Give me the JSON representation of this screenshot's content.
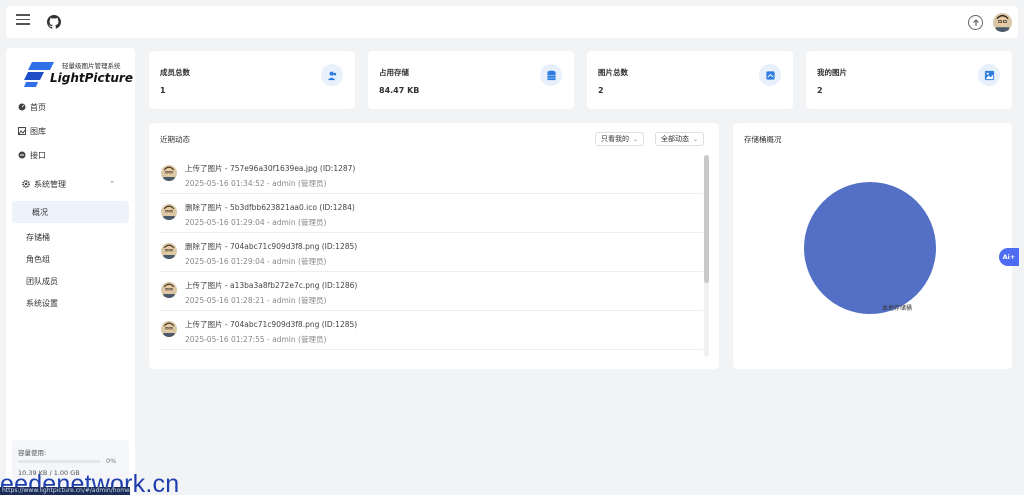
{
  "sidebar": {
    "logo_sub": "轻量级图片管理系统",
    "logo_main": "LightPicture",
    "items": [
      {
        "label": "首页",
        "icon": "dashboard-icon"
      },
      {
        "label": "图库",
        "icon": "image-icon"
      },
      {
        "label": "接口",
        "icon": "api-icon"
      },
      {
        "label": "系统管理",
        "icon": "gear-icon"
      }
    ],
    "sub_items": [
      {
        "label": "概况"
      },
      {
        "label": "存储桶"
      },
      {
        "label": "角色组"
      },
      {
        "label": "团队成员"
      },
      {
        "label": "系统设置"
      }
    ],
    "usage": {
      "label": "容量使用:",
      "percent_text": "0%",
      "percent": 0,
      "size_text": "10.39 KB / 1.00 GB"
    }
  },
  "stats": [
    {
      "title": "成员总数",
      "value": "1",
      "icon": "users-icon",
      "color": "#2f7de1"
    },
    {
      "title": "占用存储",
      "value": "84.47 KB",
      "icon": "database-icon",
      "color": "#2f7de1"
    },
    {
      "title": "图片总数",
      "value": "2",
      "icon": "photos-icon",
      "color": "#2f7de1"
    },
    {
      "title": "我的图片",
      "value": "2",
      "icon": "my-image-icon",
      "color": "#2f7de1"
    }
  ],
  "activity": {
    "title": "近期动态",
    "filter_mine": "只看我的",
    "filter_type": "全部动态",
    "rows": [
      {
        "title": "上传了图片 - 757e96a30f1639ea.jpg    (ID:1287)",
        "meta": "2025-05-16 01:34:52 - admin (管理员)"
      },
      {
        "title": "删除了图片 - 5b3dfbb623821aa0.ico    (ID:1284)",
        "meta": "2025-05-16 01:29:04 - admin (管理员)"
      },
      {
        "title": "删除了图片 - 704abc71c909d3f8.png    (ID:1285)",
        "meta": "2025-05-16 01:29:04 - admin (管理员)"
      },
      {
        "title": "上传了图片 - a13ba3a8fb272e7c.png    (ID:1286)",
        "meta": "2025-05-16 01:28:21 - admin (管理员)"
      },
      {
        "title": "上传了图片 - 704abc71c909d3f8.png    (ID:1285)",
        "meta": "2025-05-16 01:27:55 - admin (管理员)"
      }
    ]
  },
  "storage": {
    "title": "存储桶概况"
  },
  "chart_data": {
    "type": "pie",
    "title": "",
    "slices": [
      {
        "label": "本地存储桶",
        "value": 100,
        "color": "#5470c6"
      }
    ]
  },
  "ai_badge": "Ai+",
  "watermark": "eedenetwork.cn",
  "status_strip": "https://www.lightpicture.cn/#/admin/home"
}
